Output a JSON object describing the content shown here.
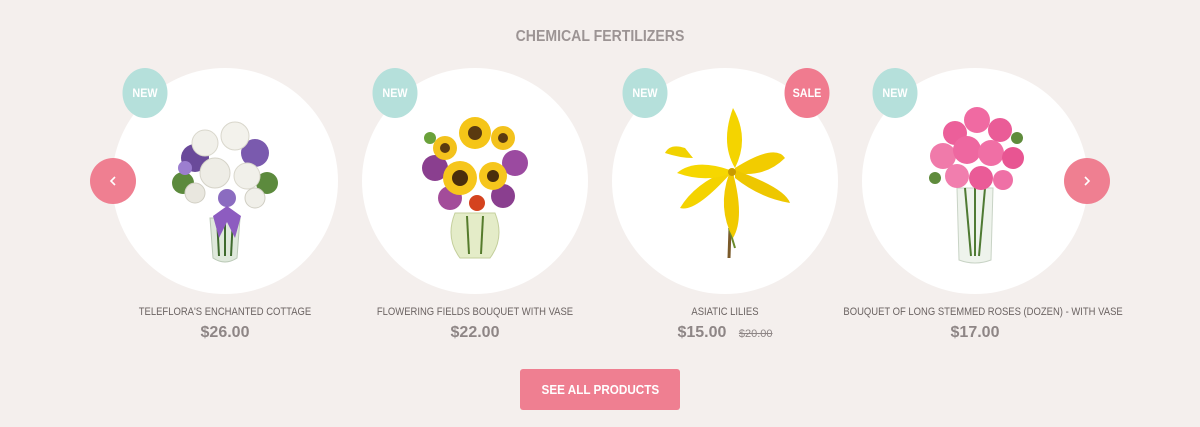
{
  "section": {
    "title": "CHEMICAL FERTILIZERS"
  },
  "products": [
    {
      "name": "TELEFLORA'S ENCHANTED COTTAGE",
      "price": "$26.00",
      "old_price": "",
      "badges": [
        "NEW"
      ],
      "image_icon": "lavender-white-rose-bouquet"
    },
    {
      "name": "FLOWERING FIELDS BOUQUET WITH VASE",
      "price": "$22.00",
      "old_price": "",
      "badges": [
        "NEW"
      ],
      "image_icon": "sunflower-bouquet"
    },
    {
      "name": "ASIATIC LILIES",
      "price": "$15.00",
      "old_price": "$20.00",
      "badges": [
        "NEW",
        "SALE"
      ],
      "image_icon": "yellow-lily"
    },
    {
      "name": "BOUQUET OF LONG STEMMED ROSES (DOZEN) - WITH VASE",
      "price": "$17.00",
      "old_price": "",
      "badges": [
        "NEW"
      ],
      "image_icon": "pink-roses-vase"
    }
  ],
  "badges": {
    "new": "NEW",
    "sale": "SALE"
  },
  "navigation": {
    "prev_icon": "chevron-left-icon",
    "next_icon": "chevron-right-icon"
  },
  "cta": {
    "label": "SEE ALL PRODUCTS"
  },
  "colors": {
    "background": "#f4efed",
    "accent": "#ef7f91",
    "new_badge": "#b5e0db",
    "text": "#8e8686"
  }
}
